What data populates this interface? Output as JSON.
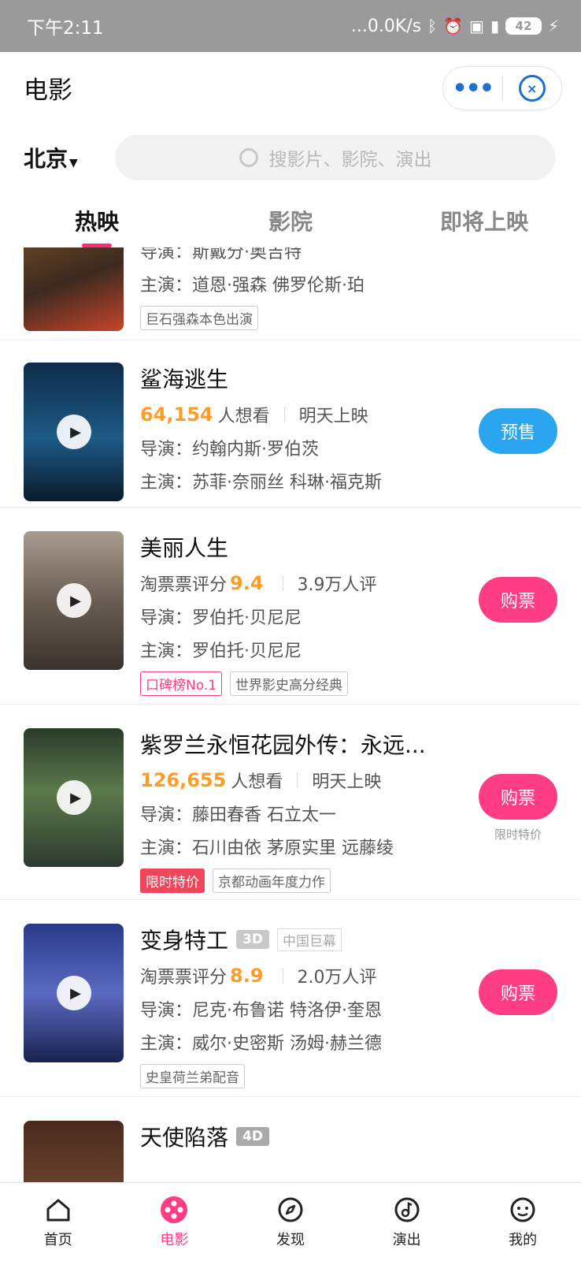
{
  "status": {
    "time": "下午2:11",
    "net": "...0.0K/s",
    "battery": "42"
  },
  "header": {
    "title": "电影"
  },
  "location": {
    "city": "北京"
  },
  "search": {
    "placeholder": "搜影片、影院、演出"
  },
  "tabs": [
    {
      "label": "热映"
    },
    {
      "label": "影院"
    },
    {
      "label": "即将上映"
    }
  ],
  "movies": [
    {
      "name": "",
      "line1": "导演：斯戴分·奥吉特",
      "line2": "主演：道恩·强森 佛罗伦斯·珀",
      "tags": [
        "巨石强森本色出演"
      ],
      "poster_color": "#6b4a2a"
    },
    {
      "name": "鲨海逃生",
      "stat_value": "64,154",
      "stat_label": "人想看",
      "stat_right": "明天上映",
      "director": "导演：约翰内斯·罗伯茨",
      "cast": "主演：苏菲·奈丽丝 科琳·福克斯",
      "button": "预售",
      "poster_color": "#1d4c7a"
    },
    {
      "name": "美丽人生",
      "stat_label": "淘票票评分",
      "stat_value": "9.4",
      "stat_right": "3.9万人评",
      "director": "导演：罗伯托·贝尼尼",
      "cast": "主演：罗伯托·贝尼尼",
      "tags": [
        "口碑榜No.1",
        "世界影史高分经典"
      ],
      "button": "购票",
      "poster_color": "#7a6d62"
    },
    {
      "name": "紫罗兰永恒花园外传：永远...",
      "stat_value": "126,655",
      "stat_label": "人想看",
      "stat_right": "明天上映",
      "director": "导演：藤田春香 石立太一",
      "cast": "主演：石川由依 茅原实里 远藤绫",
      "tags": [
        "限时特价",
        "京都动画年度力作"
      ],
      "button": "购票",
      "button_sub": "限时特价",
      "poster_color": "#3e5a3c"
    },
    {
      "name": "变身特工",
      "badge": "3D",
      "badge2": "中国巨幕",
      "stat_label": "淘票票评分",
      "stat_value": "8.9",
      "stat_right": "2.0万人评",
      "director": "导演：尼克·布鲁诺 特洛伊·奎恩",
      "cast": "主演：威尔·史密斯 汤姆·赫兰德",
      "tags": [
        "史皇荷兰弟配音"
      ],
      "button": "购票",
      "poster_color": "#2d3f7a"
    },
    {
      "name": "天使陷落",
      "badge": "4D",
      "poster_color": "#5a3a2a"
    }
  ],
  "tabbar": [
    {
      "label": "首页",
      "icon": "home-icon"
    },
    {
      "label": "电影",
      "icon": "film-reel-icon"
    },
    {
      "label": "发现",
      "icon": "compass-icon"
    },
    {
      "label": "演出",
      "icon": "music-note-icon"
    },
    {
      "label": "我的",
      "icon": "profile-icon"
    }
  ],
  "colors": {
    "accent": "#ff3d85",
    "presale": "#2aa6f0",
    "orange": "#ff9c26"
  }
}
